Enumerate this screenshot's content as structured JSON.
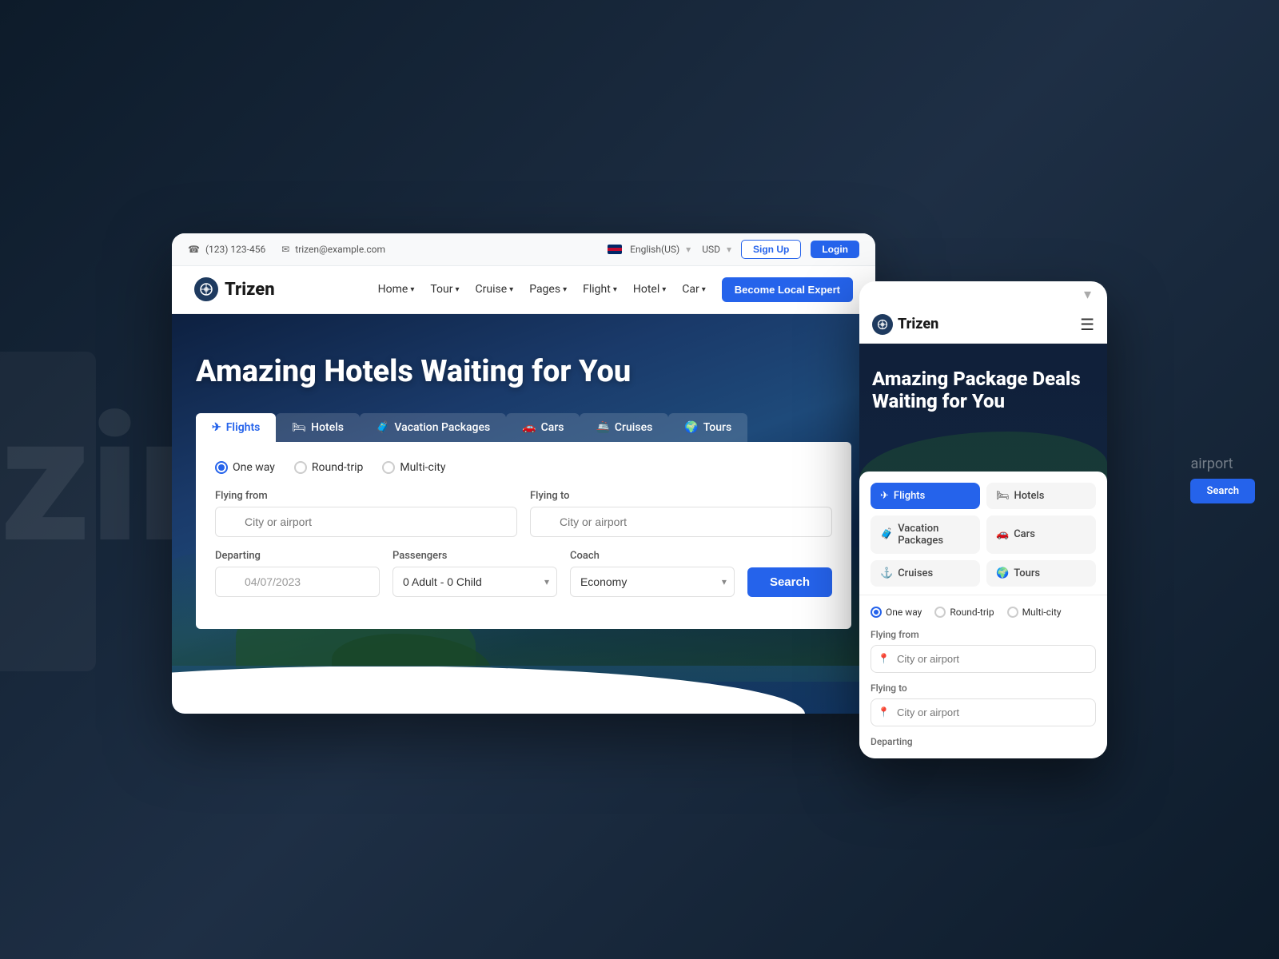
{
  "brand": {
    "name": "Trizen",
    "logo_char": "⚙"
  },
  "topbar": {
    "phone": "(123) 123-456",
    "email": "trizen@example.com",
    "language": "English(US)",
    "currency": "USD",
    "signup_label": "Sign Up",
    "login_label": "Login"
  },
  "navbar": {
    "links": [
      {
        "label": "Home",
        "has_dropdown": true
      },
      {
        "label": "Tour",
        "has_dropdown": true
      },
      {
        "label": "Cruise",
        "has_dropdown": true
      },
      {
        "label": "Pages",
        "has_dropdown": true
      },
      {
        "label": "Flight",
        "has_dropdown": true
      },
      {
        "label": "Hotel",
        "has_dropdown": true
      },
      {
        "label": "Car",
        "has_dropdown": true
      }
    ],
    "cta_label": "Become Local Expert"
  },
  "hero": {
    "title": "Amazing Hotels Waiting for You",
    "tabs": [
      {
        "id": "flights",
        "label": "Flights",
        "icon": "✈",
        "active": true
      },
      {
        "id": "hotels",
        "label": "Hotels",
        "icon": "🛏"
      },
      {
        "id": "vacation",
        "label": "Vacation Packages",
        "icon": "🧳"
      },
      {
        "id": "cars",
        "label": "Cars",
        "icon": "🚗"
      },
      {
        "id": "cruises",
        "label": "Cruises",
        "icon": "🚢"
      },
      {
        "id": "tours",
        "label": "Tours",
        "icon": "🌍"
      }
    ]
  },
  "search_form": {
    "trip_types": [
      {
        "label": "One way",
        "value": "one-way",
        "selected": true
      },
      {
        "label": "Round-trip",
        "value": "round-trip",
        "selected": false
      },
      {
        "label": "Multi-city",
        "value": "multi-city",
        "selected": false
      }
    ],
    "flying_from_label": "Flying from",
    "flying_from_placeholder": "City or airport",
    "flying_to_label": "Flying to",
    "flying_to_placeholder": "City or airport",
    "departing_label": "Departing",
    "departing_value": "04/07/2023",
    "passengers_label": "Passengers",
    "passengers_value": "0 Adult - 0 Child",
    "coach_label": "Coach",
    "coach_value": "Economy",
    "search_button": "Search"
  },
  "mobile": {
    "hero_title": "Amazing Package Deals Waiting for You",
    "tabs": [
      {
        "id": "flights",
        "label": "Flights",
        "icon": "✈",
        "active": true
      },
      {
        "id": "hotels",
        "label": "Hotels",
        "icon": "🛏"
      },
      {
        "id": "vacation",
        "label": "Vacation Packages",
        "icon": "🧳"
      },
      {
        "id": "cars",
        "label": "Cars",
        "icon": "🚗"
      },
      {
        "id": "cruises",
        "label": "Cruises",
        "icon": "⚓"
      },
      {
        "id": "tours",
        "label": "Tours",
        "icon": "🌍"
      }
    ],
    "trip_types": [
      {
        "label": "One way",
        "selected": true
      },
      {
        "label": "Round-trip",
        "selected": false
      },
      {
        "label": "Multi-city",
        "selected": false
      }
    ],
    "flying_from_label": "Flying from",
    "flying_from_placeholder": "City or airport",
    "flying_to_label": "Flying to",
    "flying_to_placeholder": "City or airport",
    "departing_label": "Departing"
  },
  "bg": {
    "watermark": "zin",
    "airport_text": "airport",
    "search_btn": "Search"
  }
}
